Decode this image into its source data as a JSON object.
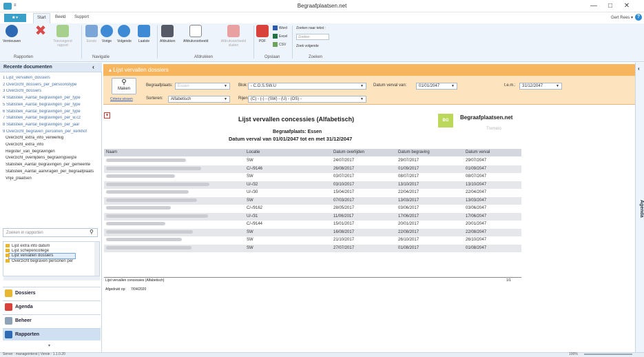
{
  "window": {
    "title": "Begraafplaatsen.net",
    "qat": "≡",
    "user": "Gert Rees ▾",
    "help": "?",
    "controls": [
      "—",
      "□",
      "✕"
    ]
  },
  "tabs": {
    "file": "■ ▾",
    "start": "Start",
    "beeld": "Beeld",
    "support": "Support"
  },
  "ribbon": {
    "buttons": [
      "Vernieuwen",
      "Vorige",
      "Volgende",
      "Laatste",
      "Afdrukken",
      "Afdrukvoorbeeld",
      "Afdrukvoorbeeld sluiten",
      "PDF"
    ],
    "disabled_buttons": [
      "Toevoegend rapport",
      "Eerste"
    ],
    "export": [
      "Word",
      "Excel",
      "CSV"
    ],
    "search_label": "Zoeken naar tekst :",
    "search_placeholder": "Zoeken",
    "search_next": "Zoek volgende",
    "groups": [
      "Rapporten",
      "Navigatie",
      "Afdrukken",
      "Opslaan",
      "Zoeken"
    ]
  },
  "sidebar": {
    "title": "Recente documenten",
    "collapse": "‹",
    "recent": [
      "1 Lijst_vervallen_dossiers",
      "2 Overzicht_dossiers_per_persoonstype",
      "3 Overzicht_dossiers",
      "4 Statistiek_Aantal_begravingen_per_type",
      "5 Statistiek_Aantal_begravingen_per_type",
      "6 Statistiek_Aantal_begravingen_per_type",
      "7 Statistiek_Aantal_begravingen_per_w.cz",
      "8 Statistiek_Aantal_begravingen_per_jaar",
      "9 Overzicht_begraven_personen_per_kerkhof",
      "Overzicht_extra_info_verwerkig",
      "Overzicht_extra_info",
      "Register_van_begravingen",
      "Overzicht_overlijdens_begravingswijze",
      "Statistiek_Aantal_begravingen_per_gemeente",
      "Statistiek_Aantal_aanvragen_per_begraafplaats",
      "Vrije_plaatsen"
    ],
    "search_placeholder": "Zoeken in rapporten",
    "list": [
      "Lijst extra info datum",
      "Lijst schepencollege",
      "Lijst vervallen dossiers",
      "Overzicht begraven personen per"
    ],
    "nav": [
      "Dossiers",
      "Agenda",
      "Beheer",
      "Rapporten"
    ]
  },
  "status": {
    "left": "Server : manageinterst | Versie : 1.1.0.20",
    "zoom": "100%"
  },
  "panel": {
    "title": "▴ Lijst vervallen dossiers",
    "agenda": "Agenda"
  },
  "filter": {
    "make_label": "Maken",
    "criteria_link": "Criteria wissen",
    "begraafplaats_label": "Begraafplaats:",
    "begraafplaats_value": "Essen",
    "sorteren_label": "Sorteren:",
    "sorteren_value": "Alfabetisch",
    "blok_label": "Blok:",
    "blok_value": "- C.O.S.SW.U",
    "rijen_label": "Rijen:",
    "rijen_value": "(C) - (-) - (SW) - (U) - (OS) -",
    "datum_van_label": "Datum verval van:",
    "datum_van_value": "01/01/2047",
    "tem_label": "t.e.m.:",
    "tem_value": "31/12/2047"
  },
  "report": {
    "title": "Lijst vervallen concessies (Alfabetisch)",
    "logo": "BG",
    "brand": "Begraafplaatsen.net",
    "brand_sub": "Tremelo",
    "sub1": "Begraafplaats: Essen",
    "sub2": "Datum verval van 01/01/2047 tot en met 31/12/2047",
    "columns": [
      "Naam",
      "Locatie",
      "Datum overlijden",
      "Datum begraving",
      "Datum verval"
    ],
    "rows": [
      {
        "loc": "SW",
        "d1": "24/07/2017",
        "d2": "29/07/2017",
        "d3": "29/07/2047"
      },
      {
        "loc": "C/-/9146",
        "d1": "26/08/2017",
        "d2": "01/09/2017",
        "d3": "01/09/2047"
      },
      {
        "loc": "SW",
        "d1": "03/07/2017",
        "d2": "08/07/2017",
        "d3": "08/07/2047"
      },
      {
        "loc": "U/-/32",
        "d1": "03/10/2017",
        "d2": "13/10/2017",
        "d3": "13/10/2047"
      },
      {
        "loc": "U/-/30",
        "d1": "15/04/2017",
        "d2": "22/04/2017",
        "d3": "22/04/2047"
      },
      {
        "loc": "SW",
        "d1": "07/03/2017",
        "d2": "13/03/2017",
        "d3": "13/03/2047"
      },
      {
        "loc": "C/-/9162",
        "d1": "28/05/2017",
        "d2": "03/06/2017",
        "d3": "03/06/2047"
      },
      {
        "loc": "U/-/31",
        "d1": "11/06/2017",
        "d2": "17/06/2017",
        "d3": "17/06/2047"
      },
      {
        "loc": "C/-/9144",
        "d1": "15/01/2017",
        "d2": "20/01/2017",
        "d3": "20/01/2047"
      },
      {
        "loc": "SW",
        "d1": "16/08/2017",
        "d2": "22/08/2017",
        "d3": "22/08/2047"
      },
      {
        "loc": "SW",
        "d1": "21/10/2017",
        "d2": "26/10/2017",
        "d3": "26/10/2047"
      },
      {
        "loc": "SW",
        "d1": "27/07/2017",
        "d2": "01/08/2017",
        "d3": "01/08/2047"
      }
    ],
    "footer_left": "Lijst vervallen concessies (Alfabetisch)",
    "footer_page": "1/1",
    "printed_label": "Afgedrukt op:",
    "printed_date": "7/04/2020"
  }
}
